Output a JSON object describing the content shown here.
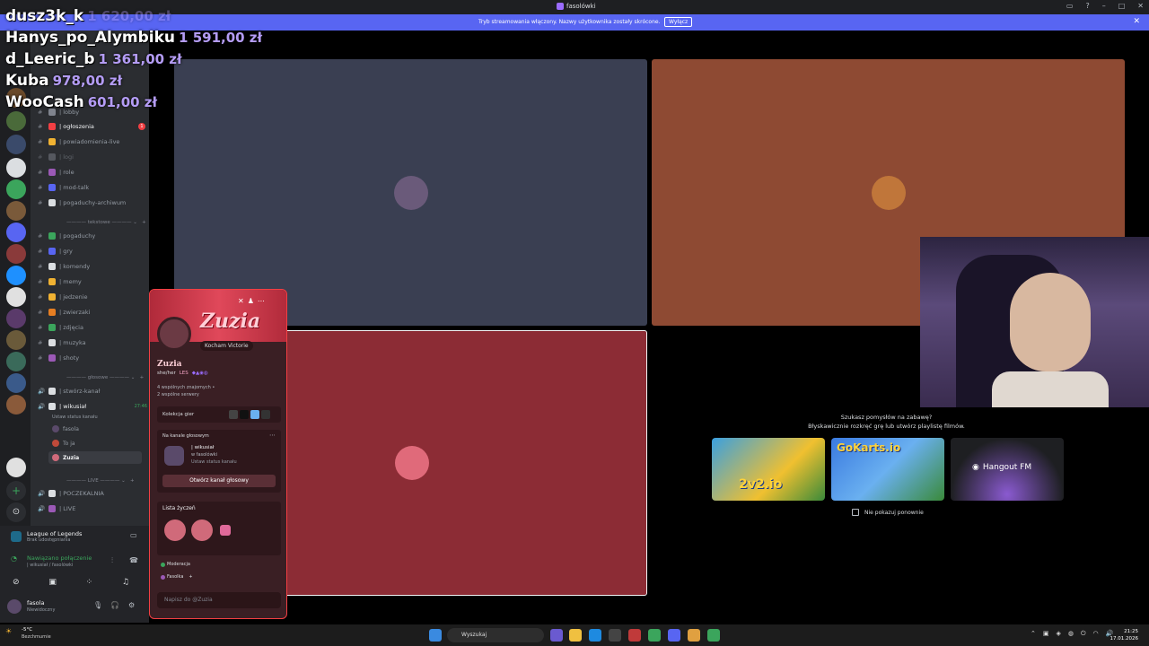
{
  "window": {
    "title": "fasolówki",
    "minimize": "–",
    "maximize": "□",
    "close": "✕"
  },
  "notice": {
    "text": "Tryb streamowania włączony. Nazwy użytkownika zostały skrócone.",
    "button": "Wyłącz",
    "close": "✕"
  },
  "donors": [
    {
      "name": "dusz3k_k",
      "amount": "1 620,00 zł"
    },
    {
      "name": "Hanys_po_Alymbiku",
      "amount": "1 591,00 zł"
    },
    {
      "name": "d_Leeric_b",
      "amount": "1 361,00 zł"
    },
    {
      "name": "Kuba",
      "amount": "978,00 zł"
    },
    {
      "name": "WooCash",
      "amount": "601,00 zł"
    }
  ],
  "channels": [
    {
      "name": "| lobby",
      "icon_color": "#80848e",
      "active": false
    },
    {
      "name": "| ogłoszenia",
      "icon_color": "#f23f43",
      "active": true,
      "badge": "1"
    },
    {
      "name": "| powiadomienia-live",
      "icon_color": "#f0b232",
      "active": false
    },
    {
      "name": "| logi",
      "icon_color": "#80848e",
      "active": false
    },
    {
      "name": "| role",
      "icon_color": "#9b59b6",
      "active": false
    },
    {
      "name": "| mod-talk",
      "icon_color": "#5865f2",
      "active": false
    },
    {
      "name": "| pogaduchy-archiwum",
      "icon_color": "#dbdee1",
      "active": false
    },
    {
      "name": "| pogaduchy",
      "icon_color": "#3ba55c",
      "active": false
    },
    {
      "name": "| gry",
      "icon_color": "#5865f2",
      "active": false
    },
    {
      "name": "| komendy",
      "icon_color": "#dbdee1",
      "active": false
    },
    {
      "name": "| memy",
      "icon_color": "#f0b232",
      "active": false
    },
    {
      "name": "| jedzenie",
      "icon_color": "#f0b232",
      "active": false
    },
    {
      "name": "| zwierzaki",
      "icon_color": "#e67e22",
      "active": false
    },
    {
      "name": "| zdjęcia",
      "icon_color": "#3ba55c",
      "active": false
    },
    {
      "name": "| muzyka",
      "icon_color": "#dbdee1",
      "active": false
    },
    {
      "name": "| shoty",
      "icon_color": "#9b59b6",
      "active": false
    }
  ],
  "categories": {
    "tekstowe": "tekstowe",
    "glosowe": "głosowe",
    "live": "LIVE"
  },
  "voice": {
    "create": "| stwórz-kanał",
    "channel": "| wikusiał",
    "time": "27:46",
    "status": "Ustaw status kanału",
    "members": [
      "fasola",
      "To ja",
      "Zuzia"
    ],
    "waiting": "| POCZEKALNIA",
    "live": "| LIVE"
  },
  "userpanel": {
    "activity": "League of Legends",
    "activity_sub": "Brak udostępniania",
    "connected": "Nawiązano połączenie",
    "connected_sub": "| wikusiał / fasolówki",
    "username": "fasola",
    "user_status": "Niewidoczny"
  },
  "popup": {
    "banner": "Zuzia",
    "custom_status": "Kocham Victorie",
    "name": "Zuzia",
    "pronouns": "she/her",
    "tag": "LES",
    "mutuals": "4 wspólnych znajomych •",
    "servers": "2 wspólne serwery",
    "games": "Kolekcja gier",
    "in_voice": "Na kanale głosowym",
    "voice_channel": "| wikusiał",
    "voice_server": "w fasolówki",
    "voice_status": "Ustaw status kanału",
    "open_voice": "Otwórz kanał głosowy",
    "wishlist": "Lista życzeń",
    "roles": [
      "Moderacja",
      "Fasolka"
    ],
    "message_placeholder": "Napisz do @Zuzia"
  },
  "activities": {
    "heading": "Szukasz pomysłów na zabawę?",
    "subheading": "Błyskawicznie rozkręć grę lub utwórz playlistę filmów.",
    "cards": [
      "2v2.io",
      "GoKarts.io",
      "Hangout FM"
    ],
    "dont_show": "Nie pokazuj ponownie"
  },
  "taskbar": {
    "weather_temp": "-5°C",
    "weather_desc": "Bezchmurnie",
    "search": "Wyszukaj",
    "time": "21:25",
    "date": "17.01.2026"
  },
  "colors": {
    "tile_blue": "#3a3f52",
    "tile_orange": "#8e4a33",
    "tile_red": "#8c2c35",
    "accent": "#5865f2",
    "popup_border": "#f23f43"
  }
}
